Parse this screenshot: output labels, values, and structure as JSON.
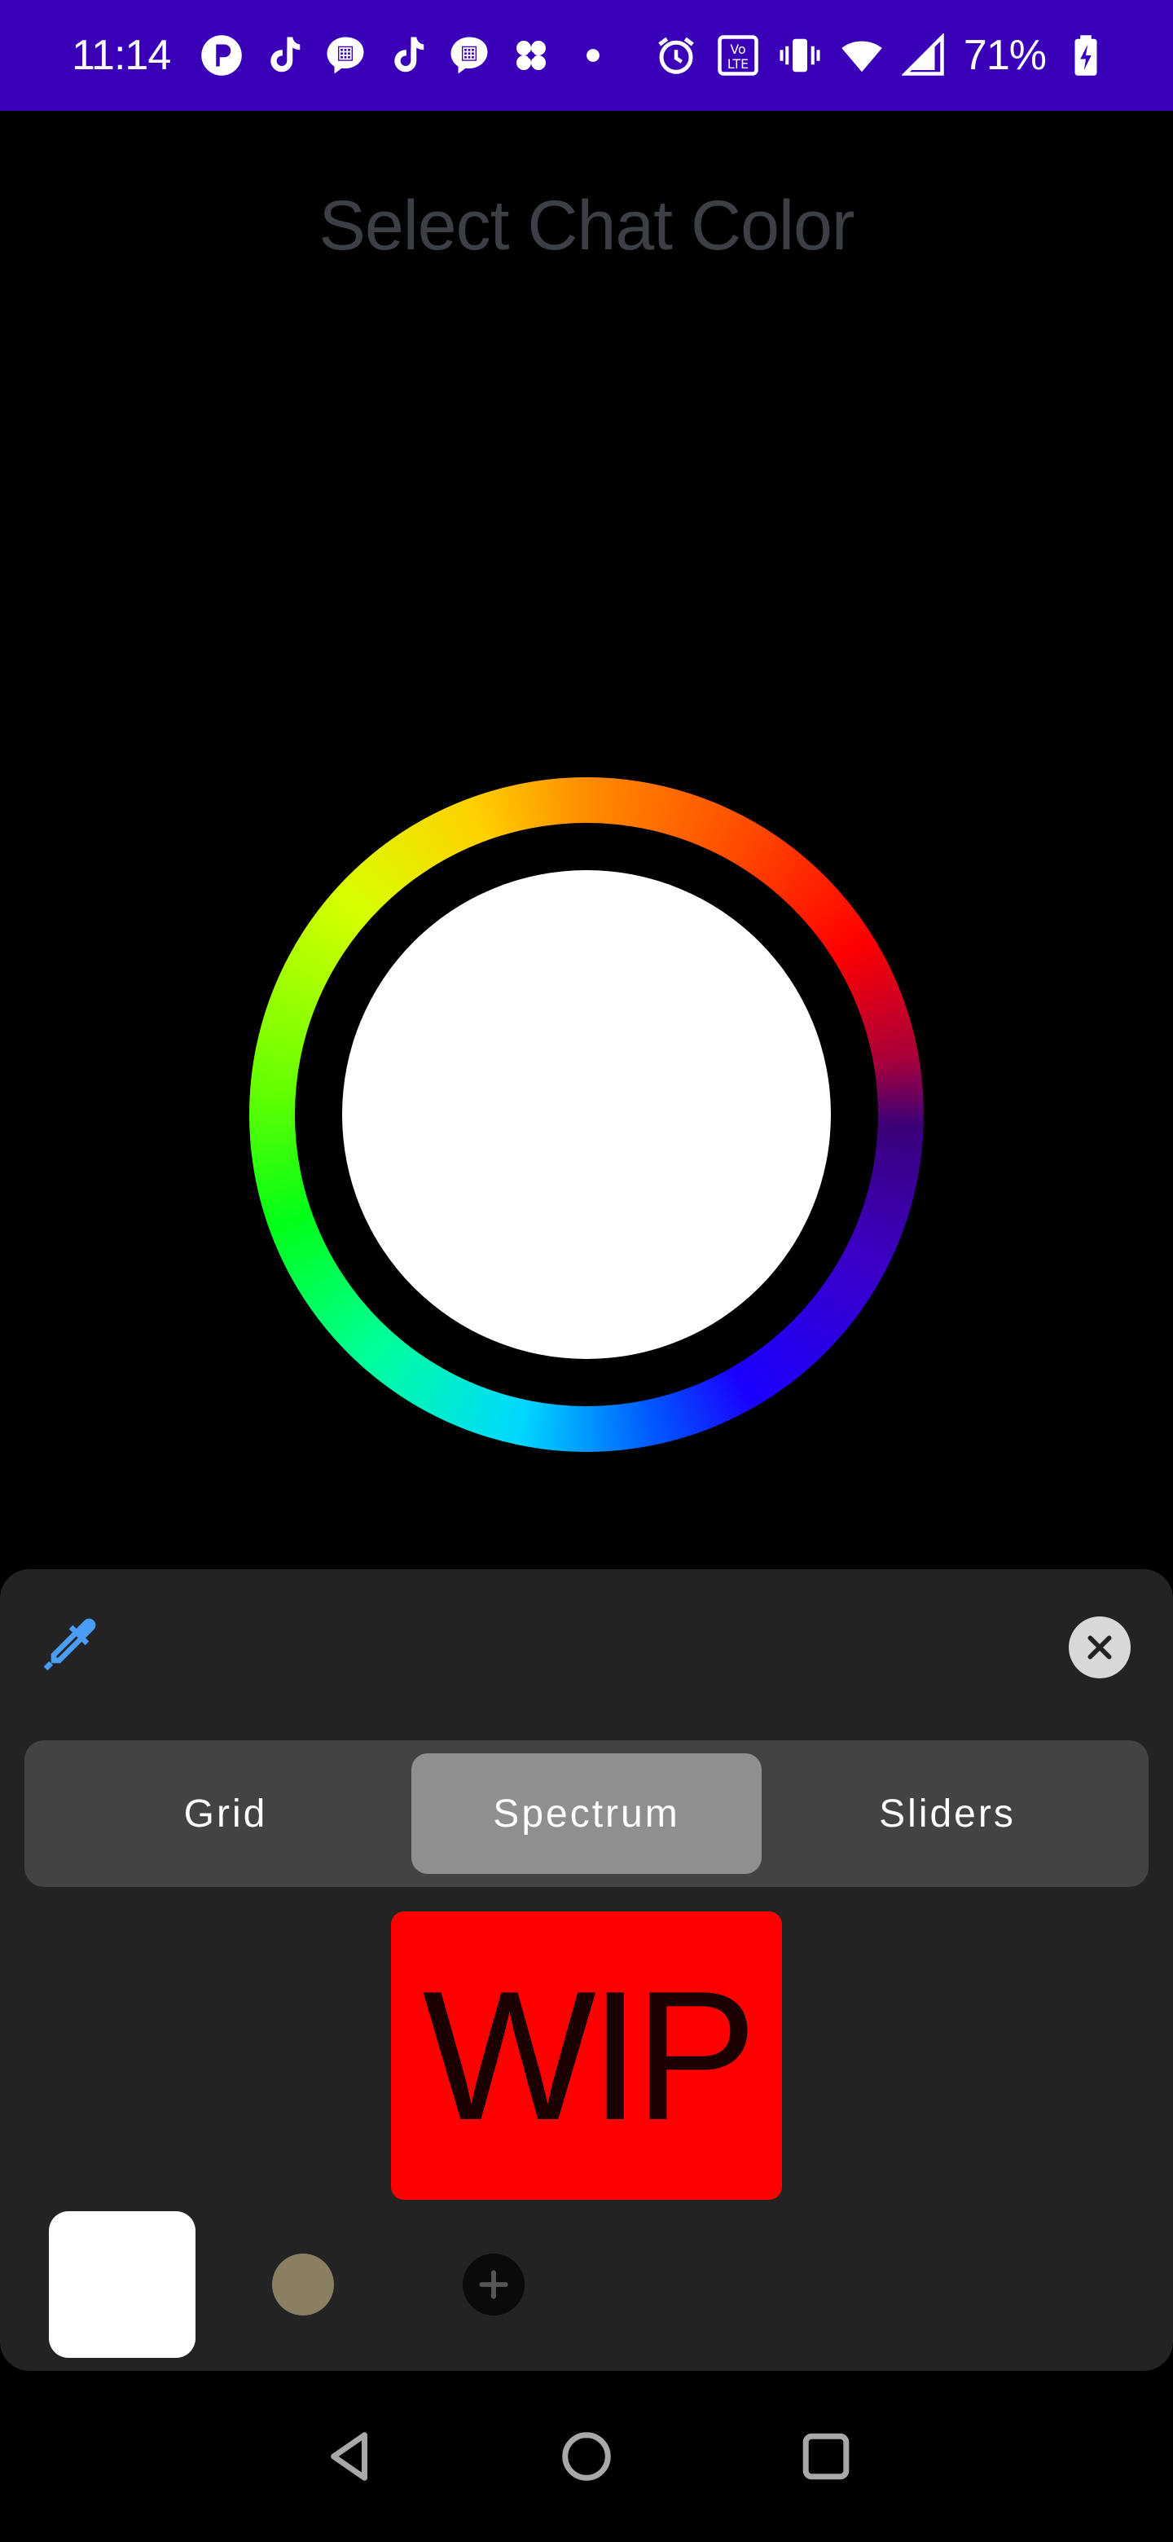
{
  "status_bar": {
    "time": "11:14",
    "battery_percent": "71%",
    "background_color": "#3a00b8",
    "notification_icons": [
      "app-p-icon",
      "tiktok-icon",
      "chat-bubble-icon",
      "tiktok-icon",
      "chat-bubble-icon",
      "clover-icon",
      "dot-icon"
    ],
    "system_icons": [
      "alarm-icon",
      "volte-icon",
      "vibrate-icon",
      "wifi-icon",
      "signal-icon",
      "battery-charging-icon"
    ]
  },
  "page": {
    "title": "Select Chat Color"
  },
  "color_wheel": {
    "selected_color": "#ffffff"
  },
  "sheet": {
    "tabs": [
      {
        "label": "Grid",
        "selected": false
      },
      {
        "label": "Spectrum",
        "selected": true
      },
      {
        "label": "Sliders",
        "selected": false
      }
    ],
    "wip_label": "WIP",
    "wip_color": "#ff0000",
    "swatches": [
      {
        "color": "#ffffff",
        "selected": true
      },
      {
        "color": "#8a7f63",
        "selected": false
      }
    ],
    "add_swatch_icon": "plus-icon",
    "eyedropper_icon": "eyedropper-icon",
    "close_icon": "close-icon"
  },
  "nav_bar": {
    "buttons": [
      "back-icon",
      "home-icon",
      "recents-icon"
    ]
  }
}
